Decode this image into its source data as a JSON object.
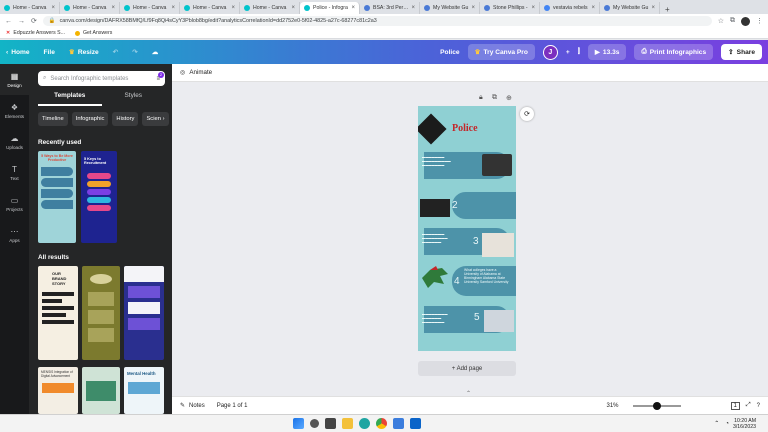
{
  "browser": {
    "tabs": [
      {
        "label": "Home - Canva",
        "fav": "#00c4cc"
      },
      {
        "label": "Home - Canva",
        "fav": "#00c4cc"
      },
      {
        "label": "Home - Canva",
        "fav": "#00c4cc"
      },
      {
        "label": "Home - Canva",
        "fav": "#00c4cc"
      },
      {
        "label": "Home - Canva",
        "fav": "#00c4cc"
      },
      {
        "label": "Police - Infogra",
        "fav": "#00c4cc"
      },
      {
        "label": "BSA: 3rd Period",
        "fav": "#4a7ad6"
      },
      {
        "label": "My Website Gu",
        "fav": "#4a7ad6"
      },
      {
        "label": "Stone Phillips -",
        "fav": "#4a7ad6"
      },
      {
        "label": "vestavia rebels",
        "fav": "#4285f4"
      },
      {
        "label": "My Website Gu",
        "fav": "#4a7ad6"
      }
    ],
    "url": "canva.com/design/DAFRX58BMfQ/Lf9Fq8Qi4sCyY3Pblob8bg/edit?analyticsCorrelationId=dd2752e0-5f02-4825-a27c-68277c81c2a3",
    "bookmarks": [
      "Edpuzzle Answers S...",
      "Get Answers"
    ]
  },
  "topbar": {
    "home": "Home",
    "file": "File",
    "resize": "Resize",
    "doc_title": "Police",
    "try_pro": "Try Canva Pro",
    "avatar": "J",
    "timer": "13.3s",
    "print": "Print Infographics",
    "share": "Share"
  },
  "rail": [
    {
      "label": "Design",
      "icon": "design-icon"
    },
    {
      "label": "Elements",
      "icon": "elements-icon"
    },
    {
      "label": "Uploads",
      "icon": "uploads-icon"
    },
    {
      "label": "Text",
      "icon": "text-icon"
    },
    {
      "label": "Projects",
      "icon": "projects-icon"
    },
    {
      "label": "Apps",
      "icon": "apps-icon"
    }
  ],
  "panel": {
    "search_placeholder": "Search Infographic templates",
    "filter_badge": "2",
    "tabs": [
      "Templates",
      "Styles"
    ],
    "chips": [
      "Timeline",
      "Infographic",
      "History",
      "Scien"
    ],
    "recently_used": "Recently used",
    "all_results": "All results",
    "thumb_texts": {
      "recent1": "5 Ways to Be More Productive",
      "recent2": "5 Keys to Recruitment",
      "result1": "OUR BRAND STORY",
      "result4": "MENSIS Integration of Digital Advancement",
      "result6": "Mental Health"
    }
  },
  "editor": {
    "animate": "Animate",
    "add_page": "+ Add page",
    "notes": "Notes",
    "page_info": "Page 1 of 1",
    "zoom": "31%"
  },
  "design": {
    "title": "Police",
    "numbers": [
      "2",
      "3",
      "4",
      "5"
    ],
    "seg4_text": "What colleges have a University of Alabama at Birmingham Alabama State University Samford University"
  },
  "taskbar": {
    "time": "10:20 AM",
    "date": "3/16/2023"
  },
  "colors": {
    "brand_gradient_start": "#12b4c6",
    "brand_gradient_end": "#7a3fe0",
    "design_bg": "#8fd0d3",
    "design_segment": "#4d93a9"
  }
}
